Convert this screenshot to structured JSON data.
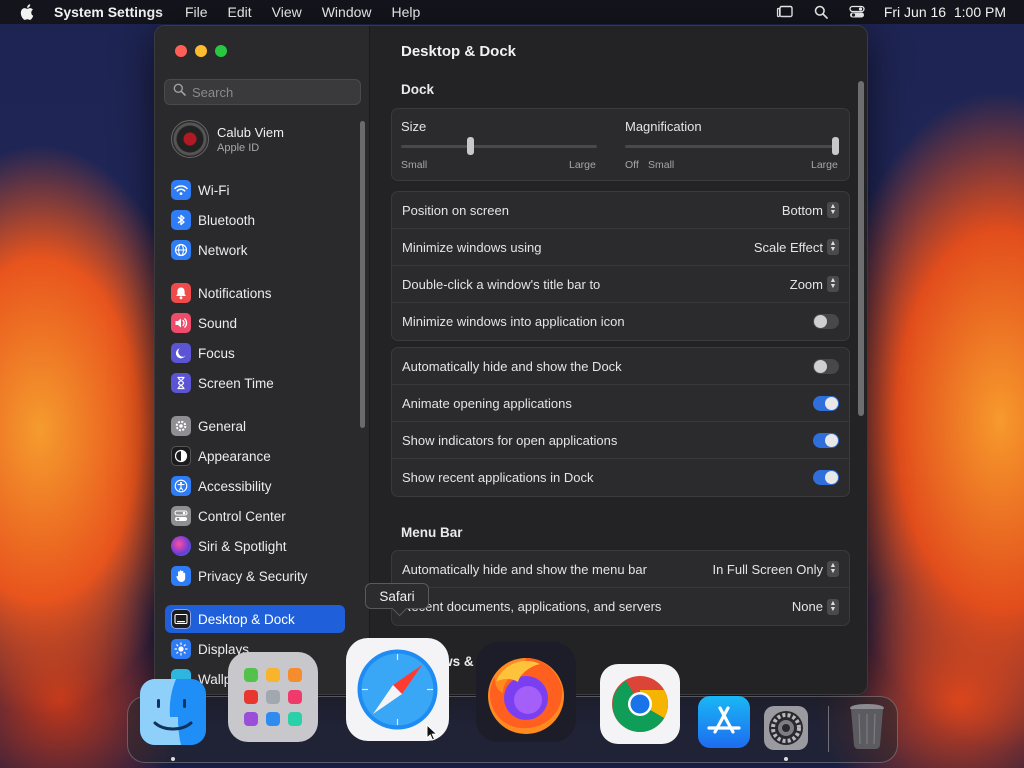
{
  "menubar": {
    "app": "System Settings",
    "menus": [
      "File",
      "Edit",
      "View",
      "Window",
      "Help"
    ],
    "clock": "Fri Jun 16  1:00 PM"
  },
  "sidebar": {
    "search_placeholder": "Search",
    "account": {
      "name": "Calub Viem",
      "subtitle": "Apple ID"
    },
    "items": [
      {
        "label": "Wi-Fi",
        "icon": "wifi-icon",
        "color": "#2e7cf6"
      },
      {
        "label": "Bluetooth",
        "icon": "bluetooth-icon",
        "color": "#2e7cf6"
      },
      {
        "label": "Network",
        "icon": "globe-icon",
        "color": "#2e7cf6"
      },
      {
        "label": "Notifications",
        "icon": "bell-icon",
        "color": "#ef4b4b"
      },
      {
        "label": "Sound",
        "icon": "speaker-icon",
        "color": "#ef4b6a"
      },
      {
        "label": "Focus",
        "icon": "moon-icon",
        "color": "#5b55d6"
      },
      {
        "label": "Screen Time",
        "icon": "hourglass-icon",
        "color": "#5b55d6"
      },
      {
        "label": "General",
        "icon": "gear-icon",
        "color": "#8e8e93"
      },
      {
        "label": "Appearance",
        "icon": "appearance-icon",
        "color": "#1c1c1e"
      },
      {
        "label": "Accessibility",
        "icon": "accessibility-icon",
        "color": "#2e7cf6"
      },
      {
        "label": "Control Center",
        "icon": "control-center-icon",
        "color": "#8e8e93"
      },
      {
        "label": "Siri & Spotlight",
        "icon": "siri-icon",
        "color": "#7a3fd6"
      },
      {
        "label": "Privacy & Security",
        "icon": "hand-icon",
        "color": "#2e7cf6"
      },
      {
        "label": "Desktop & Dock",
        "icon": "desktop-icon",
        "color": "#1c1c1e"
      },
      {
        "label": "Displays",
        "icon": "sun-icon",
        "color": "#2e7cf6"
      },
      {
        "label": "Wallpaper",
        "icon": "wallpaper-icon",
        "color": "#2eb5e0"
      }
    ]
  },
  "content": {
    "title": "Desktop & Dock",
    "dock_section": "Dock",
    "size": {
      "label": "Size",
      "min_label": "Small",
      "max_label": "Large",
      "value": 0.35
    },
    "magnification": {
      "label": "Magnification",
      "off_label": "Off",
      "min_label": "Small",
      "max_label": "Large",
      "value": 1.0
    },
    "rows1": [
      {
        "label": "Position on screen",
        "value": "Bottom"
      },
      {
        "label": "Minimize windows using",
        "value": "Scale Effect"
      },
      {
        "label": "Double-click a window's title bar to",
        "value": "Zoom"
      },
      {
        "label": "Minimize windows into application icon",
        "toggle": false
      }
    ],
    "rows2": [
      {
        "label": "Automatically hide and show the Dock",
        "toggle": false
      },
      {
        "label": "Animate opening applications",
        "toggle": true
      },
      {
        "label": "Show indicators for open applications",
        "toggle": true
      },
      {
        "label": "Show recent applications in Dock",
        "toggle": true
      }
    ],
    "menubar_section": "Menu Bar",
    "rows3": [
      {
        "label": "Automatically hide and show the menu bar",
        "value": "In Full Screen Only"
      },
      {
        "label": "Recent documents, applications, and servers",
        "value": "None"
      }
    ],
    "next_section": "Windows & Apps"
  },
  "tooltip": "Safari",
  "dock": {
    "apps": [
      "Finder",
      "Launchpad",
      "Safari",
      "Firefox",
      "Google Chrome",
      "App Store",
      "System Settings",
      "Trash"
    ]
  }
}
